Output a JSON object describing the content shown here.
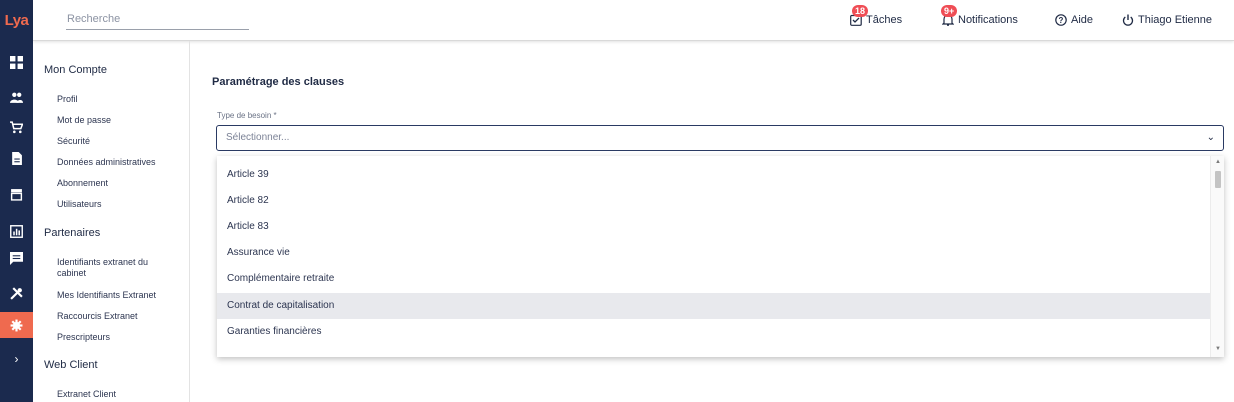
{
  "app": {
    "logo_text": "Lya"
  },
  "search": {
    "placeholder": "Recherche"
  },
  "topbar": {
    "tasks": {
      "label": "Tâches",
      "badge": "18"
    },
    "notifications": {
      "label": "Notifications",
      "badge": "9+"
    },
    "help": {
      "label": "Aide"
    },
    "user": {
      "label": "Thiago Etienne"
    }
  },
  "rail": {
    "icons": [
      "dashboard-icon",
      "people-icon",
      "cart-icon",
      "document-icon",
      "store-icon",
      "chart-icon",
      "message-icon",
      "tools-icon",
      "settings-icon",
      "chevron-right-icon"
    ],
    "active": "settings-icon"
  },
  "menu": {
    "sections": [
      {
        "title": "Mon Compte",
        "items": [
          "Profil",
          "Mot de passe",
          "Sécurité",
          "Données administratives",
          "Abonnement",
          "Utilisateurs"
        ]
      },
      {
        "title": "Partenaires",
        "items": [
          "Identifiants extranet du cabinet",
          "Mes Identifiants Extranet",
          "Raccourcis Extranet",
          "Prescripteurs"
        ]
      },
      {
        "title": "Web Client",
        "items": [
          "Extranet Client"
        ]
      }
    ]
  },
  "main": {
    "title": "Paramétrage des clauses",
    "field_label": "Type de besoin *",
    "select_placeholder": "Sélectionner...",
    "options": [
      "Article 39",
      "Article 82",
      "Article 83",
      "Assurance vie",
      "Complémentaire retraite",
      "Contrat de capitalisation",
      "Garanties financières"
    ],
    "highlighted_option": "Contrat de capitalisation"
  },
  "colors": {
    "rail": "#1b2a4e",
    "accent": "#ef6a4f",
    "badge": "#ef4d55"
  }
}
